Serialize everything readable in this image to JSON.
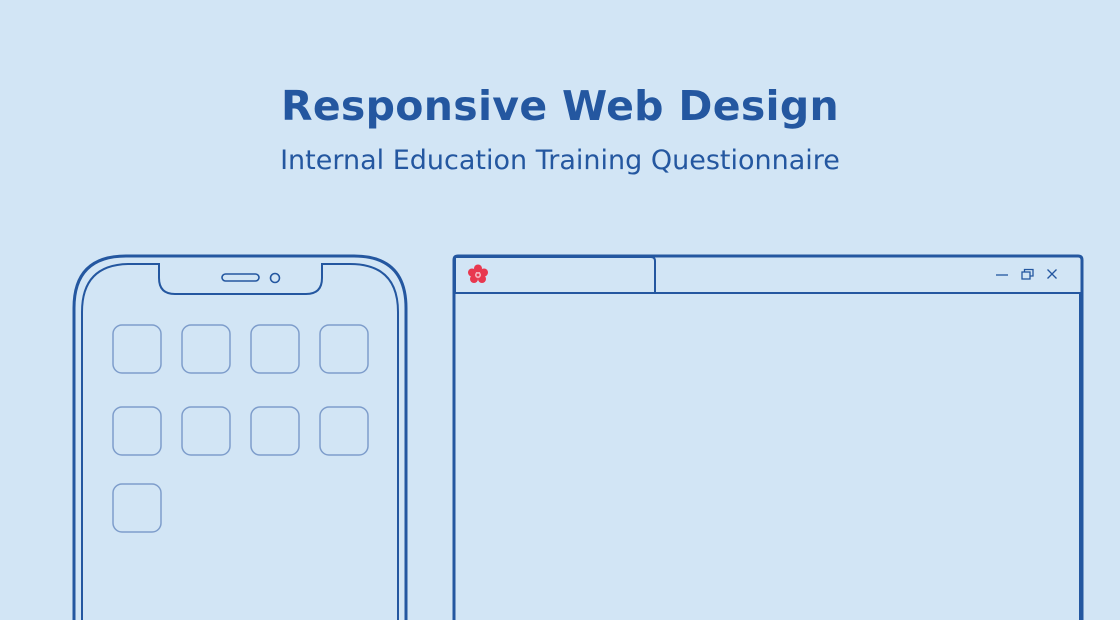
{
  "header": {
    "title": "Responsive Web Design",
    "subtitle": "Internal Education Training Questionnaire"
  },
  "colors": {
    "background": "#d2e5f5",
    "accent": "#2457a0",
    "icon_outline": "#7e9dcb",
    "logo": "#e8384f"
  },
  "phone": {
    "app_icon_count": 9
  },
  "browser_window": {
    "favicon": "flower-logo-icon",
    "controls": [
      "minimize-icon",
      "restore-icon",
      "close-icon"
    ]
  }
}
